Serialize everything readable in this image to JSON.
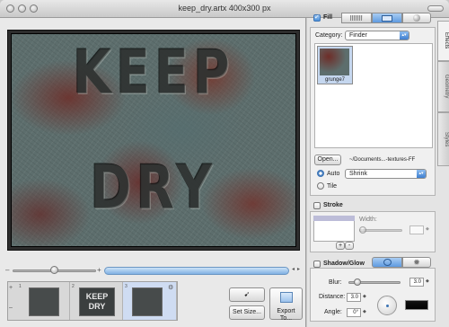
{
  "window": {
    "title": "keep_dry.artx 400x300 px"
  },
  "canvas": {
    "line1": "KEEP",
    "line2": "DRY"
  },
  "filmstrip": {
    "items": [
      {
        "num": "1",
        "label": ""
      },
      {
        "num": "2",
        "label": "KEEP DRY"
      },
      {
        "num": "3",
        "label": ""
      }
    ]
  },
  "toolbar": {
    "set_size_label": "Set Size...",
    "export_label": "Export To..."
  },
  "tabs": [
    "Effects",
    "Geometry",
    "Styles"
  ],
  "fill": {
    "label": "Fill",
    "enabled": true,
    "category_label": "Category:",
    "category_value": "Finder",
    "texture_name": "grunge7",
    "open_label": "Open...",
    "path": "~/Documents...-textures-FF",
    "auto_label": "Auto",
    "auto_mode": "Shrink",
    "tile_label": "Tile"
  },
  "stroke": {
    "label": "Stroke",
    "enabled": false,
    "width_label": "Width:",
    "add_label": "+",
    "remove_label": "-"
  },
  "shadow": {
    "label": "Shadow/Glow",
    "enabled": false,
    "blur_label": "Blur:",
    "blur_value": "3.0",
    "distance_label": "Distance:",
    "distance_value": "3.0",
    "angle_label": "Angle:",
    "angle_value": "0°"
  },
  "colors": {
    "accent": "#4a8fd9",
    "rust": "#6e2d28",
    "metal": "#5d6e6d"
  }
}
